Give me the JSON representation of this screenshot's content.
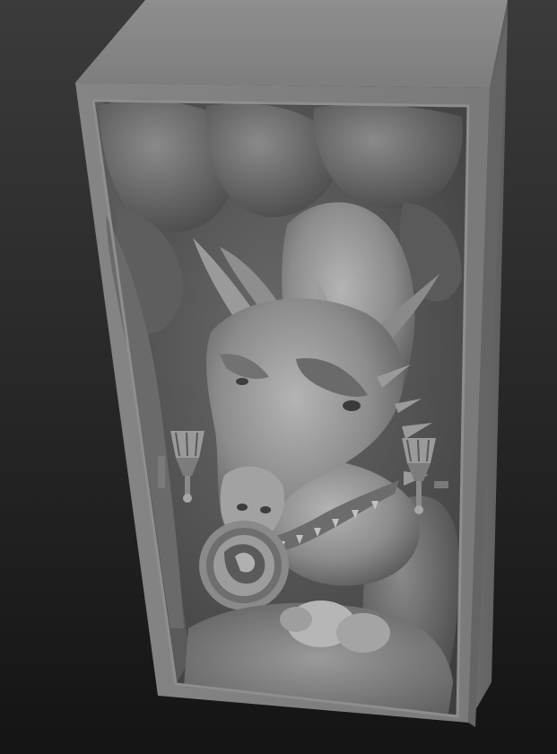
{
  "scene": {
    "subject": "dragon-head-diorama-sculpt",
    "icons": [
      "dragon-head-icon",
      "torch-icon",
      "shield-emblem-icon",
      "rock-wall-icon"
    ],
    "colors": {
      "background_top": "#3b3b3b",
      "background_bottom": "#141414",
      "clay_light": "#a8a8a8",
      "clay_mid": "#7a7a7a",
      "clay_dark": "#4a4a4a",
      "shadow": "#2c2c2c"
    }
  }
}
